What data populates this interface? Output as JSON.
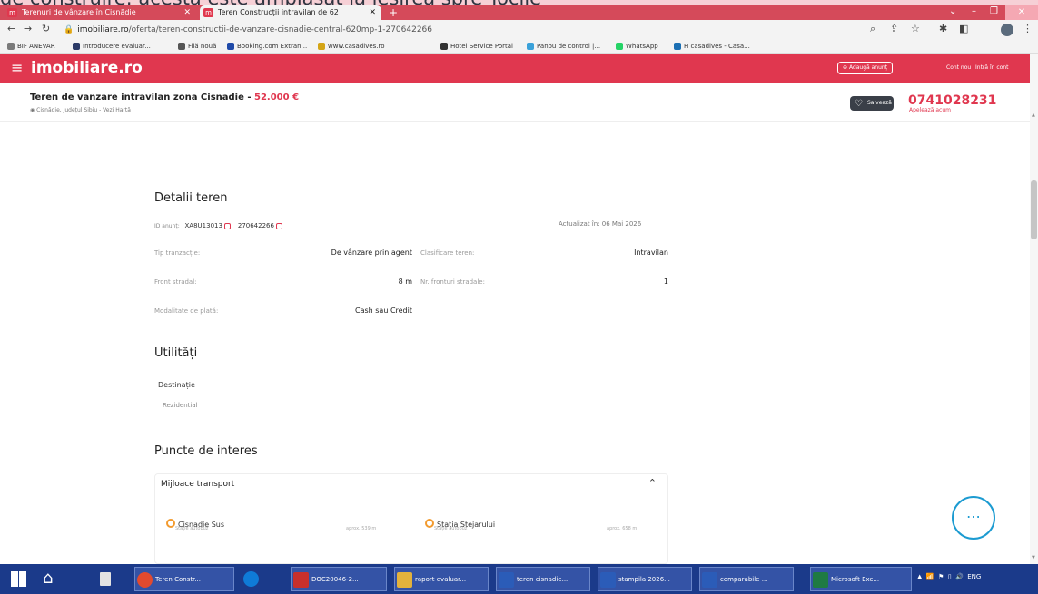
{
  "clipped_text": "de construire: acesta este amplasat la ieșirea spre Tocile",
  "browser": {
    "tabs": [
      {
        "label": "Terenuri de vânzare în Cisnădie",
        "favicon": "imobiliare-favicon"
      },
      {
        "label": "Teren Construcții intravilan de 62",
        "favicon": "imobiliare-favicon"
      }
    ],
    "new_tab": "+",
    "url_host": "imobiliare.ro",
    "url_path": "/oferta/teren-constructii-de-vanzare-cisnadie-central-620mp-1-270642266",
    "bookmarks": [
      {
        "label": "BIF ANEVAR",
        "color": "#7a7a7a"
      },
      {
        "label": "Introducere evaluar...",
        "color": "#2b3a67"
      },
      {
        "label": "Filă nouă",
        "color": "#555555"
      },
      {
        "label": "Booking.com Extran...",
        "color": "#1f4aa8"
      },
      {
        "label": "www.casadives.ro",
        "color": "#d4a516"
      },
      {
        "label": "Hotel Service Portal",
        "color": "#333333"
      },
      {
        "label": "Panou de control |...",
        "color": "#3aa1d9"
      },
      {
        "label": "WhatsApp",
        "color": "#25d366"
      },
      {
        "label": "H casadives - Casa...",
        "color": "#1b6fb3"
      }
    ]
  },
  "site": {
    "logo": "imobiliare.ro",
    "add_listing": "Adaugă anunț",
    "new_account": "Cont nou",
    "login": "Intră în cont",
    "accent": "#e0374f"
  },
  "listing": {
    "title": "Teren de vanzare intravilan zona Cisnadie - ",
    "price": "52.000 €",
    "location": "Cisnădie, Județul Sibiu - Vezi Hartă",
    "save": "Salvează",
    "phone": "0741028231",
    "call_now": "Apelează acum"
  },
  "details": {
    "heading": "Detalii teren",
    "id_label": "ID anunț:",
    "id1": "XA8U13013",
    "id2": "270642266",
    "updated": "Actualizat în: 06 Mai 2026",
    "rows": [
      {
        "label": "Tip tranzacție:",
        "value": "De vânzare prin agent",
        "label2": "Clasificare teren:",
        "value2": "Intravilan"
      },
      {
        "label": "Front stradal:",
        "value": "8 m",
        "label2": "Nr. fronturi stradale:",
        "value2": "1"
      },
      {
        "label": "Modalitate de plată:",
        "value": "Cash sau Credit"
      }
    ]
  },
  "utilities": {
    "heading": "Utilități",
    "sub": "Destinație",
    "value": "Rezidential"
  },
  "poi": {
    "heading": "Puncte de interes",
    "transport": "Mijloace transport",
    "stops": [
      {
        "name": "Cisnadie Sus",
        "type": "Stație autobuz",
        "dist": "aprox. 539 m"
      },
      {
        "name": "Stația Stejarului",
        "type": "Stație autobuz",
        "dist": "aprox. 658 m"
      }
    ]
  },
  "taskbar": {
    "apps": [
      {
        "label": "Teren Constr...",
        "color": "#e24a2f"
      },
      {
        "label": "",
        "color": "#0f7bd8"
      },
      {
        "label": "DOC20046-2...",
        "color": "#c9302c"
      },
      {
        "label": "raport evaluar...",
        "color": "#e3b23c"
      },
      {
        "label": "teren cisnadie...",
        "color": "#2b5cb8"
      },
      {
        "label": "stampila 2026...",
        "color": "#2b5cb8"
      },
      {
        "label": "comparabile ...",
        "color": "#2b5cb8"
      },
      {
        "label": "Microsoft Exc...",
        "color": "#1f7a43"
      }
    ],
    "lang": "ENG"
  }
}
